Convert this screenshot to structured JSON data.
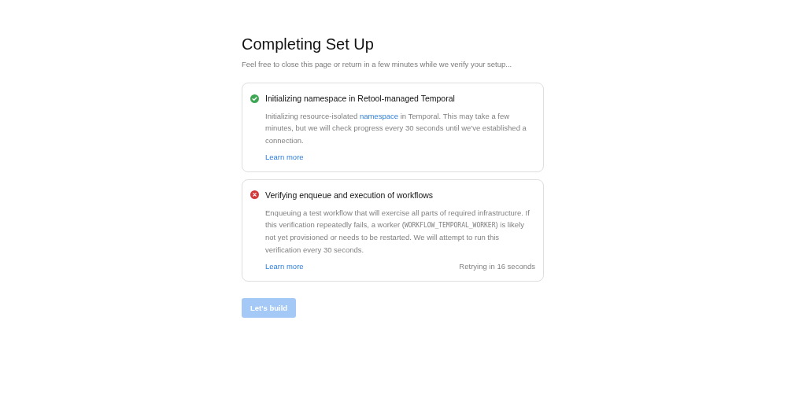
{
  "title": "Completing Set Up",
  "subtitle": "Feel free to close this page or return in a few minutes while we verify your setup...",
  "steps": [
    {
      "kind": "success",
      "title": "Initializing namespace in Retool-managed Temporal",
      "description": [
        {
          "kind": "text",
          "text": "Initializing resource-isolated "
        },
        {
          "kind": "link",
          "text": "namespace"
        },
        {
          "kind": "text",
          "text": " in Temporal. This may take a few minutes, but we will check progress every 30 seconds until we've established a connection."
        }
      ],
      "link": "Learn more"
    },
    {
      "kind": "error",
      "title": "Verifying enqueue and execution of workflows",
      "description": [
        {
          "kind": "text",
          "text": "Enqueuing a test workflow that will exercise all parts of required infrastructure. If this verification repeatedly fails, a worker ("
        },
        {
          "kind": "code",
          "text": "WORKFLOW_TEMPORAL_WORKER"
        },
        {
          "kind": "text",
          "text": ") is likely not yet provisioned or needs to be restarted. We will attempt to run this verification every 30 seconds."
        }
      ],
      "link": "Learn more",
      "retry": "Retrying in 16 seconds"
    }
  ],
  "button": {
    "label": "Let's build",
    "disabled": true
  }
}
